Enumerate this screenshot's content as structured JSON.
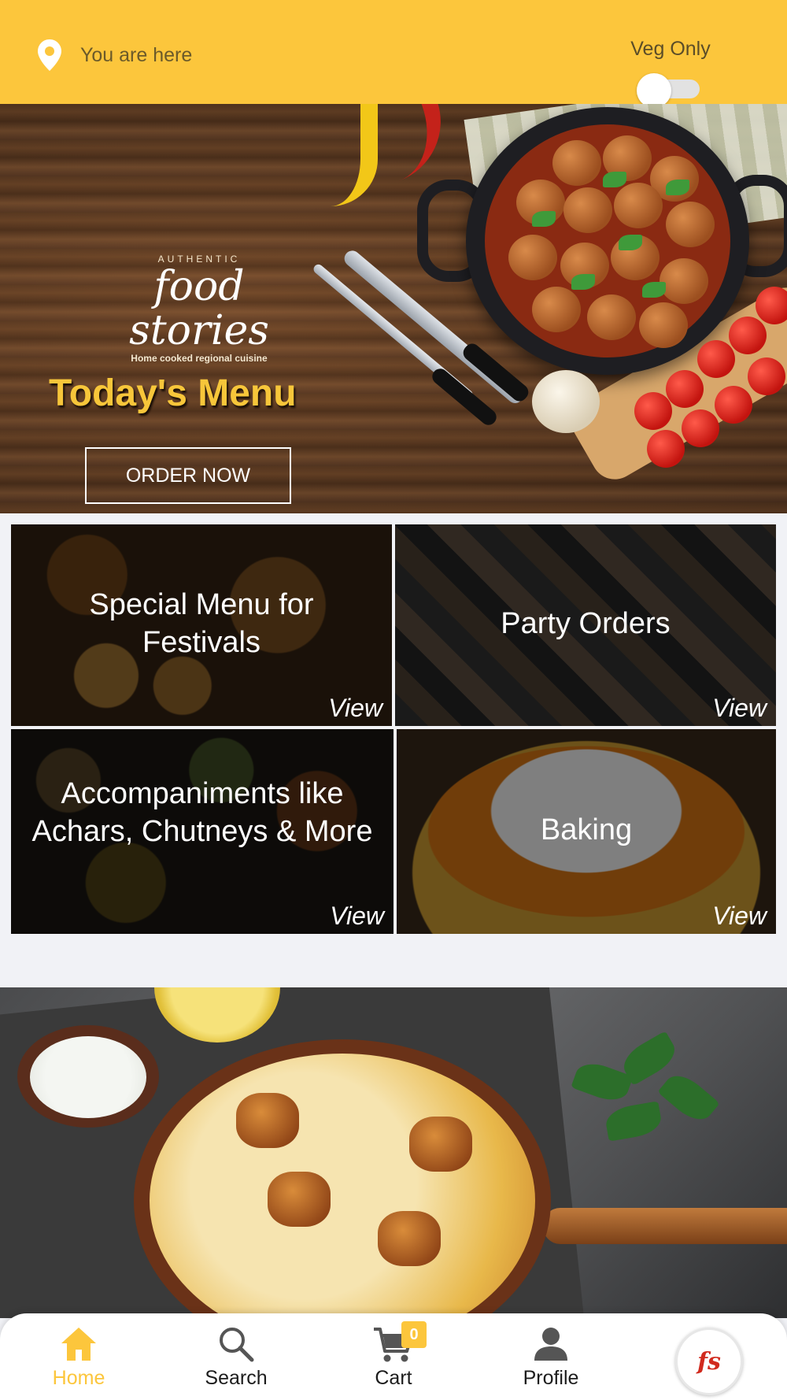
{
  "header": {
    "location_label": "You are here",
    "veg_only_label": "Veg Only",
    "veg_only_enabled": false,
    "accent_color": "#fcc63c"
  },
  "banner": {
    "brand_top": "AUTHENTIC",
    "brand_name": "food stories",
    "brand_sub": "Home cooked regional cuisine",
    "title": "Today's Menu",
    "cta_label": "ORDER NOW",
    "slides": 3,
    "active_slide": 1
  },
  "categories": [
    {
      "title": "Special Menu for Festivals",
      "view_label": "View"
    },
    {
      "title": "Party Orders",
      "view_label": "View"
    },
    {
      "title": "Accompaniments like Achars, Chutneys & More",
      "view_label": "View"
    },
    {
      "title": "Baking",
      "view_label": "View"
    }
  ],
  "nav": {
    "items": [
      {
        "label": "Home",
        "icon": "home-icon",
        "active": true
      },
      {
        "label": "Search",
        "icon": "search-icon",
        "active": false
      },
      {
        "label": "Cart",
        "icon": "cart-icon",
        "active": false
      },
      {
        "label": "Profile",
        "icon": "profile-icon",
        "active": false
      }
    ],
    "cart_count": "0",
    "logo_text": "fs"
  }
}
